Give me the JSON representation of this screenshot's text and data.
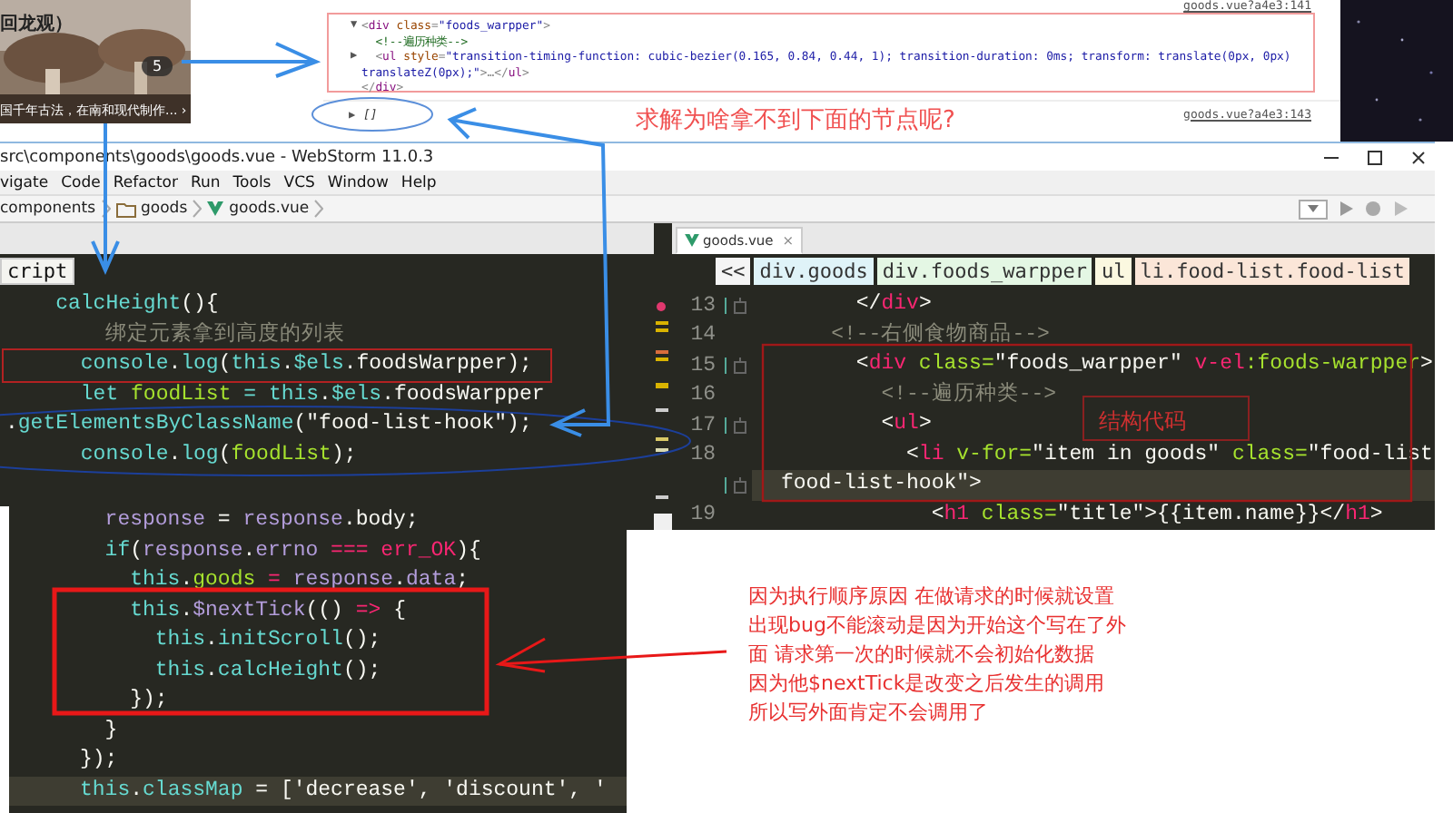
{
  "photo_card": {
    "kind": "picture",
    "title": "回龙观）",
    "badge": "5",
    "caption": "国千年古法，在南和现代制作... ›"
  },
  "devtools": {
    "sources": [
      "goods.vue?a4e3:141",
      "goods.vue?a4e3:143"
    ],
    "lines": [
      {
        "toggle": "▼",
        "tokens": [
          {
            "kind": "pl",
            "t": "<"
          },
          {
            "kind": "tg",
            "t": "div"
          },
          {
            "kind": "at",
            "t": " class"
          },
          {
            "kind": "pl",
            "t": "="
          },
          {
            "kind": "vl",
            "t": "\"foods_warpper\""
          },
          {
            "kind": "pl",
            "t": ">"
          }
        ]
      },
      {
        "tokens": [
          {
            "kind": "cm",
            "t": "  <!--遍历种类-->"
          }
        ]
      },
      {
        "toggle": "▶",
        "tokens": [
          {
            "kind": "pl",
            "t": "  <"
          },
          {
            "kind": "tg",
            "t": "ul"
          },
          {
            "kind": "at",
            "t": " style"
          },
          {
            "kind": "pl",
            "t": "="
          },
          {
            "kind": "vl",
            "t": "\"transition-timing-function: cubic-bezier(0.165, 0.84, 0.44, 1); transition-duration: 0ms; transform: translate(0px, 0px)"
          }
        ]
      },
      {
        "tokens": [
          {
            "kind": "vl",
            "t": "translateZ(0px);\""
          },
          {
            "kind": "pl",
            "t": ">…</"
          },
          {
            "kind": "tg",
            "t": "ul"
          },
          {
            "kind": "pl",
            "t": ">"
          }
        ]
      },
      {
        "tokens": [
          {
            "kind": "pl",
            "t": "</"
          },
          {
            "kind": "tg",
            "t": "div"
          },
          {
            "kind": "pl",
            "t": ">"
          }
        ]
      }
    ],
    "result": {
      "toggle": "▶",
      "text": "[]"
    }
  },
  "question": "求解为啥拿不到下面的节点呢?",
  "window": {
    "title": "src\\components\\goods\\goods.vue - WebStorm 11.0.3"
  },
  "menu": [
    "vigate",
    "Code",
    "Refactor",
    "Run",
    "Tools",
    "VCS",
    "Window",
    "Help"
  ],
  "nav": [
    {
      "label": "components",
      "kind": "text"
    },
    {
      "label": "goods",
      "kind": "folder"
    },
    {
      "label": "goods.vue",
      "kind": "vue"
    }
  ],
  "left_editor": {
    "tab": "cript",
    "lines": [
      {
        "boxed": false,
        "tokens": [
          {
            "kind": "kw",
            "t": "    calcHeight"
          },
          {
            "kind": "pl",
            "t": "(){"
          }
        ]
      },
      {
        "boxed": false,
        "tokens": [
          {
            "kind": "cm",
            "t": "        绑定元素拿到高度的列表"
          }
        ]
      },
      {
        "boxed": true,
        "tokens": [
          {
            "kind": "kw",
            "t": "      console"
          },
          {
            "kind": "pl",
            "t": "."
          },
          {
            "kind": "kw",
            "t": "log"
          },
          {
            "kind": "pl",
            "t": "("
          },
          {
            "kind": "kw",
            "t": "this"
          },
          {
            "kind": "pl",
            "t": "."
          },
          {
            "kind": "kw",
            "t": "$els"
          },
          {
            "kind": "pl",
            "t": ".foodsWarpper);"
          }
        ]
      },
      {
        "boxed": false,
        "tokens": [
          {
            "kind": "kw",
            "t": "      let "
          },
          {
            "kind": "fn",
            "t": "foodList"
          },
          {
            "kind": "kw",
            "t": " = this"
          },
          {
            "kind": "pl",
            "t": "."
          },
          {
            "kind": "kw",
            "t": "$els"
          },
          {
            "kind": "pl",
            "t": ".foodsWarpper"
          }
        ]
      },
      {
        "boxed": false,
        "tokens": [
          {
            "kind": "pl",
            "t": "."
          },
          {
            "kind": "kw",
            "t": "getElementsByClassName"
          },
          {
            "kind": "pl",
            "t": "(\"food-list-hook\");"
          }
        ]
      },
      {
        "boxed": false,
        "tokens": [
          {
            "kind": "kw",
            "t": "      console"
          },
          {
            "kind": "pl",
            "t": "."
          },
          {
            "kind": "kw",
            "t": "log"
          },
          {
            "kind": "pl",
            "t": "("
          },
          {
            "kind": "fn",
            "t": "foodList"
          },
          {
            "kind": "pl",
            "t": ");"
          }
        ]
      }
    ]
  },
  "right_editor": {
    "tab": {
      "label": "goods.vue",
      "close": "×",
      "selected": true
    },
    "crumbs": [
      {
        "label": "<<",
        "color": "#f4f4f4"
      },
      {
        "label": "div.goods",
        "color": "#dff3f8"
      },
      {
        "label": "div.foods_warpper",
        "color": "#e4f7e4"
      },
      {
        "label": "ul",
        "color": "#fbf8e0"
      },
      {
        "label": "li.food-list.food-list",
        "color": "#fbe6d8"
      }
    ],
    "lines": [
      {
        "number": "13",
        "fold": true,
        "current": false,
        "tokens": [
          {
            "kind": "pl",
            "t": "      </"
          },
          {
            "kind": "tg",
            "t": "div"
          },
          {
            "kind": "pl",
            "t": ">"
          }
        ]
      },
      {
        "number": "14",
        "fold": false,
        "current": false,
        "tokens": [
          {
            "kind": "cm",
            "t": "    <!--右侧食物商品-->"
          }
        ]
      },
      {
        "number": "15",
        "fold": true,
        "current": false,
        "tokens": [
          {
            "kind": "pl",
            "t": "      <"
          },
          {
            "kind": "tg",
            "t": "div"
          },
          {
            "kind": "fn",
            "t": " class="
          },
          {
            "kind": "pl",
            "t": "\"foods_warpper\" "
          },
          {
            "kind": "tg",
            "t": "v-el"
          },
          {
            "kind": "fn",
            "t": ":foods-warpper"
          },
          {
            "kind": "pl",
            "t": ">"
          }
        ]
      },
      {
        "number": "16",
        "fold": false,
        "current": false,
        "tokens": [
          {
            "kind": "cm",
            "t": "        <!--遍历种类-->"
          }
        ]
      },
      {
        "number": "17",
        "fold": true,
        "current": false,
        "tokens": [
          {
            "kind": "pl",
            "t": "        <"
          },
          {
            "kind": "tg",
            "t": "ul"
          },
          {
            "kind": "pl",
            "t": ">"
          }
        ]
      },
      {
        "number": "18",
        "fold": false,
        "current": false,
        "tokens": [
          {
            "kind": "pl",
            "t": "          <"
          },
          {
            "kind": "tg",
            "t": "li"
          },
          {
            "kind": "fn",
            "t": " v-for="
          },
          {
            "kind": "pl",
            "t": "\"item in goods\" "
          },
          {
            "kind": "fn",
            "t": "class="
          },
          {
            "kind": "pl",
            "t": "\"food-list"
          }
        ]
      },
      {
        "fold": true,
        "current": true,
        "tokens": [
          {
            "kind": "pl",
            "t": "food-list-hook\">"
          }
        ]
      },
      {
        "number": "19",
        "fold": false,
        "current": false,
        "tokens": [
          {
            "kind": "pl",
            "t": "            <"
          },
          {
            "kind": "tg",
            "t": "h1"
          },
          {
            "kind": "fn",
            "t": " class="
          },
          {
            "kind": "pl",
            "t": "\"title\">{{item.name}}</"
          },
          {
            "kind": "tg",
            "t": "h1"
          },
          {
            "kind": "pl",
            "t": ">"
          }
        ]
      }
    ],
    "note": "结构代码"
  },
  "bottom_code": [
    {
      "current": false,
      "tokens": [
        {
          "kind": "vr",
          "t": "  response"
        },
        {
          "kind": "pl",
          "t": " = "
        },
        {
          "kind": "vr",
          "t": "response"
        },
        {
          "kind": "pl",
          "t": ".body;"
        }
      ]
    },
    {
      "current": false,
      "tokens": [
        {
          "kind": "kw",
          "t": "  if"
        },
        {
          "kind": "pl",
          "t": "("
        },
        {
          "kind": "vr",
          "t": "response"
        },
        {
          "kind": "pl",
          "t": "."
        },
        {
          "kind": "vr",
          "t": "errno"
        },
        {
          "kind": "op",
          "t": " === err_OK"
        },
        {
          "kind": "pl",
          "t": "){"
        }
      ]
    },
    {
      "current": false,
      "tokens": [
        {
          "kind": "kw",
          "t": "    this"
        },
        {
          "kind": "pl",
          "t": "."
        },
        {
          "kind": "fn",
          "t": "goods"
        },
        {
          "kind": "op",
          "t": " = "
        },
        {
          "kind": "vr",
          "t": "response"
        },
        {
          "kind": "pl",
          "t": "."
        },
        {
          "kind": "vr",
          "t": "data"
        },
        {
          "kind": "pl",
          "t": ";"
        }
      ]
    },
    {
      "current": false,
      "tokens": [
        {
          "kind": "kw",
          "t": "    this"
        },
        {
          "kind": "pl",
          "t": "."
        },
        {
          "kind": "vr",
          "t": "$nextTick"
        },
        {
          "kind": "pl",
          "t": "(() "
        },
        {
          "kind": "op",
          "t": "=>"
        },
        {
          "kind": "pl",
          "t": " {"
        }
      ]
    },
    {
      "current": false,
      "tokens": [
        {
          "kind": "kw",
          "t": "      this"
        },
        {
          "kind": "pl",
          "t": "."
        },
        {
          "kind": "kw",
          "t": "initScroll"
        },
        {
          "kind": "pl",
          "t": "();"
        }
      ]
    },
    {
      "current": false,
      "tokens": [
        {
          "kind": "kw",
          "t": "      this"
        },
        {
          "kind": "pl",
          "t": "."
        },
        {
          "kind": "kw",
          "t": "calcHeight"
        },
        {
          "kind": "pl",
          "t": "();"
        }
      ]
    },
    {
      "current": false,
      "tokens": [
        {
          "kind": "pl",
          "t": "    });"
        }
      ]
    },
    {
      "current": false,
      "tokens": [
        {
          "kind": "pl",
          "t": "  }"
        }
      ]
    },
    {
      "current": false,
      "tokens": [
        {
          "kind": "pl",
          "t": "});"
        }
      ]
    },
    {
      "current": true,
      "tokens": [
        {
          "kind": "kw",
          "t": "this"
        },
        {
          "kind": "pl",
          "t": "."
        },
        {
          "kind": "kw",
          "t": "classMap"
        },
        {
          "kind": "pl",
          "t": " = ['decrease', 'discount', '"
        }
      ]
    }
  ],
  "explanation": [
    "因为执行顺序原因 在做请求的时候就设置",
    "出现bug不能滚动是因为开始这个写在了外",
    "面 请求第一次的时候就不会初始化数据",
    "因为他$nextTick是改变之后发生的调用",
    "所以写外面肯定不会调用了"
  ]
}
